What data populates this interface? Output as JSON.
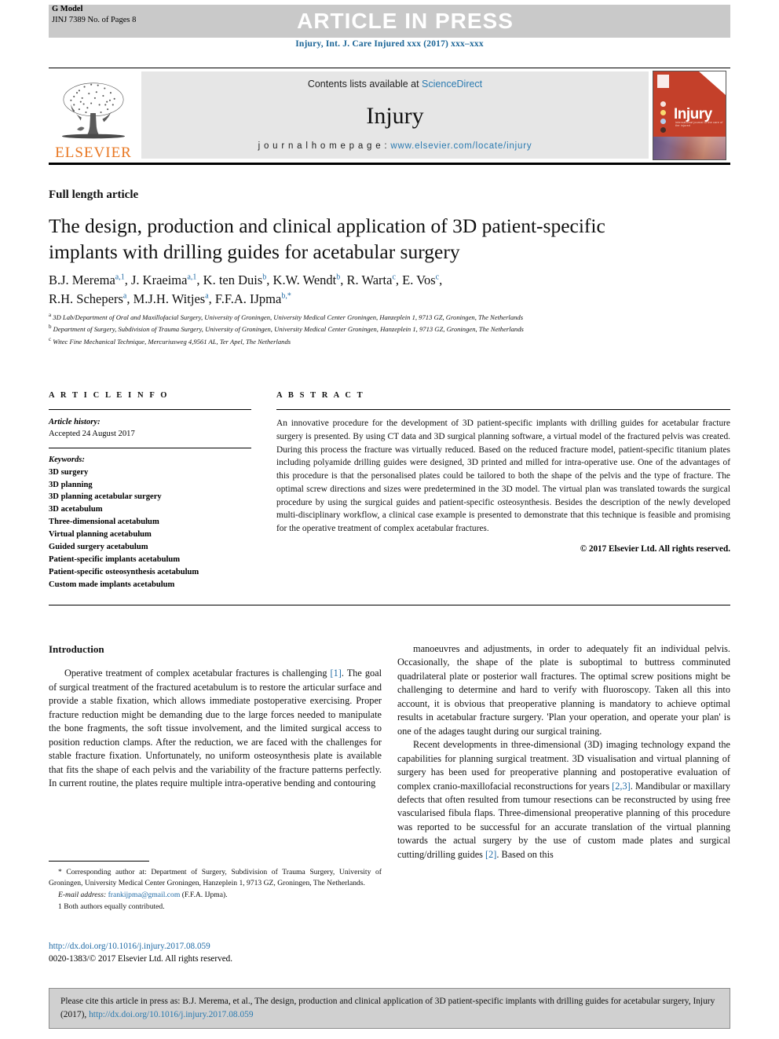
{
  "header": {
    "g_model": "G Model",
    "manuscript_id": "JINJ 7389 No. of Pages 8",
    "press_banner": "ARTICLE IN PRESS",
    "journal_citation": "Injury, Int. J. Care Injured xxx (2017) xxx–xxx"
  },
  "masthead": {
    "publisher_name": "ELSEVIER",
    "contents_prefix": "Contents lists available at ",
    "contents_link": "ScienceDirect",
    "journal_title": "Injury",
    "homepage_prefix": "j o u r n a l   h o m e p a g e :  ",
    "homepage_url": "www.elsevier.com/locate/injury",
    "cover_title": "Injury",
    "cover_subtitle": "international journal of the care of the injured"
  },
  "article": {
    "type": "Full length article",
    "title": "The design, production and clinical application of 3D patient-specific implants with drilling guides for acetabular surgery",
    "authors_line_1": "B.J. Merema",
    "authors_html_1": "B.J. Merema<sup>a,1</sup>, J. Kraeima<sup>a,1</sup>, K. ten Duis<sup>b</sup>, K.W. Wendt<sup>b</sup>, R. Warta<sup>c</sup>, E. Vos<sup>c</sup>,",
    "authors_html_2": "R.H. Schepers<sup>a</sup>, M.J.H. Witjes<sup>a</sup>, F.F.A. IJpma<sup>b,*</sup>",
    "affiliation_a": "3D Lab/Department of Oral and Maxillofacial Surgery, University of Groningen, University Medical Center Groningen, Hanzeplein 1, 9713 GZ, Groningen, The Netherlands",
    "affiliation_b": "Department of Surgery, Subdivision of Trauma Surgery, University of Groningen, University Medical Center Groningen, Hanzeplein 1, 9713 GZ, Groningen, The Netherlands",
    "affiliation_c": "Witec Fine Mechanical Technique, Mercuriusweg 4,9561 AL, Ter Apel, The Netherlands"
  },
  "info": {
    "section_label": "A R T I C L E   I N F O",
    "history_label": "Article history:",
    "history_value": "Accepted 24 August 2017",
    "keywords_label": "Keywords:",
    "keywords": [
      "3D surgery",
      "3D planning",
      "3D planning acetabular surgery",
      "3D acetabulum",
      "Three-dimensional acetabulum",
      "Virtual planning acetabulum",
      "Guided surgery acetabulum",
      "Patient-specific implants acetabulum",
      "Patient-specific osteosynthesis acetabulum",
      "Custom made implants acetabulum"
    ]
  },
  "abstract": {
    "section_label": "A B S T R A C T",
    "text": "An innovative procedure for the development of 3D patient-specific implants with drilling guides for acetabular fracture surgery is presented. By using CT data and 3D surgical planning software, a virtual model of the fractured pelvis was created. During this process the fracture was virtually reduced. Based on the reduced fracture model, patient-specific titanium plates including polyamide drilling guides were designed, 3D printed and milled for intra-operative use. One of the advantages of this procedure is that the personalised plates could be tailored to both the shape of the pelvis and the type of fracture. The optimal screw directions and sizes were predetermined in the 3D model. The virtual plan was translated towards the surgical procedure by using the surgical guides and patient-specific osteosynthesis. Besides the description of the newly developed multi-disciplinary workflow, a clinical case example is presented to demonstrate that this technique is feasible and promising for the operative treatment of complex acetabular fractures.",
    "copyright": "© 2017 Elsevier Ltd. All rights reserved."
  },
  "body": {
    "intro_heading": "Introduction",
    "left_p1_a": "Operative treatment of complex acetabular fractures is challenging ",
    "left_p1_ref": "[1]",
    "left_p1_b": ". The goal of surgical treatment of the fractured acetabulum is to restore the articular surface and provide a stable fixation, which allows immediate postoperative exercising. Proper fracture reduction might be demanding due to the large forces needed to manipulate the bone fragments, the soft tissue involvement, and the limited surgical access to position reduction clamps. After the reduction, we are faced with the challenges for stable fracture fixation. Unfortunately, no uniform osteosynthesis plate is available that fits the shape of each pelvis and the variability of the fracture patterns perfectly. In current routine, the plates require multiple intra-operative bending and contouring",
    "right_p1": "manoeuvres and adjustments, in order to adequately fit an individual pelvis. Occasionally, the shape of the plate is suboptimal to buttress comminuted quadrilateral plate or posterior wall fractures. The optimal screw positions might be challenging to determine and hard to verify with fluoroscopy. Taken all this into account, it is obvious that preoperative planning is mandatory to achieve optimal results in acetabular fracture surgery. 'Plan your operation, and operate your plan' is one of the adages taught during our surgical training.",
    "right_p2_a": "Recent developments in three-dimensional (3D) imaging technology expand the capabilities for planning surgical treatment. 3D visualisation and virtual planning of surgery has been used for preoperative planning and postoperative evaluation of complex cranio-maxillofacial reconstructions for years ",
    "right_p2_ref1": "[2,3]",
    "right_p2_b": ". Mandibular or maxillary defects that often resulted from tumour resections can be reconstructed by using free vascularised fibula flaps. Three-dimensional preoperative planning of this procedure was reported to be successful for an accurate translation of the virtual planning towards the actual surgery by the use of custom made plates and surgical cutting/drilling guides ",
    "right_p2_ref2": "[2]",
    "right_p2_c": ". Based on this"
  },
  "footnotes": {
    "corresponding": "* Corresponding author at: Department of Surgery, Subdivision of Trauma Surgery, University of Groningen, University Medical Center Groningen, Hanzeplein 1, 9713 GZ, Groningen, The Netherlands.",
    "email_label": "E-mail address:",
    "email": "frankijpma@gmail.com",
    "email_owner": "(F.F.A. IJpma).",
    "equal_contribution": "1 Both authors equally contributed.",
    "doi_url": "http://dx.doi.org/10.1016/j.injury.2017.08.059",
    "issn_line": "0020-1383/© 2017 Elsevier Ltd. All rights reserved."
  },
  "citation_box": {
    "text": "Please cite this article in press as: B.J. Merema, et al., The design, production and clinical application of 3D patient-specific implants with drilling guides for acetabular surgery, Injury (2017), ",
    "link": "http://dx.doi.org/10.1016/j.injury.2017.08.059"
  },
  "colors": {
    "link_blue": "#1f6aa5",
    "elsevier_orange": "#e87722",
    "banner_gray": "#c9c9c9",
    "cover_red": "#c4402a"
  }
}
